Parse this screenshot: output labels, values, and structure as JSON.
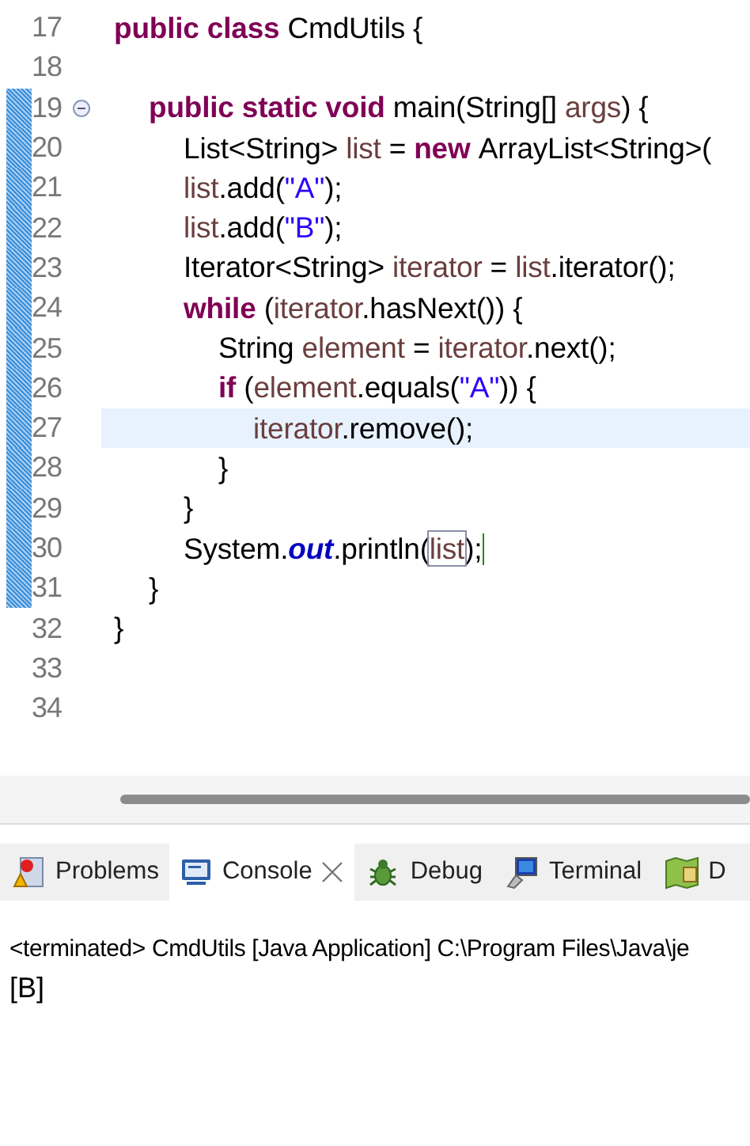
{
  "editor": {
    "lines": [
      {
        "number": "17",
        "changed": false,
        "current": false,
        "tokens": [
          {
            "text": "public class ",
            "kind": "keyword"
          },
          {
            "text": "CmdUtils {",
            "kind": "plain"
          }
        ],
        "children": [
          {
            "number": "18",
            "changed": false,
            "current": false
          },
          {
            "number": "19",
            "changed": true,
            "current": false,
            "folded": false,
            "tokens": [
              {
                "text": "public static void ",
                "kind": "keyword"
              },
              {
                "text": "main(String[] ",
                "kind": "plain"
              },
              {
                "text": "args",
                "kind": "local"
              },
              {
                "text": ") {",
                "kind": "plain"
              }
            ],
            "children": [
              {
                "number": "20",
                "changed": true,
                "current": false,
                "tokens": [
                  {
                    "text": "List<String> ",
                    "kind": "plain"
                  },
                  {
                    "text": "list",
                    "kind": "local"
                  },
                  {
                    "text": " = ",
                    "kind": "plain"
                  },
                  {
                    "text": "new ",
                    "kind": "keyword"
                  },
                  {
                    "text": "ArrayList<String>(",
                    "kind": "plain"
                  }
                ]
              },
              {
                "number": "21",
                "changed": true,
                "current": false,
                "tokens": [
                  {
                    "text": "list",
                    "kind": "local"
                  },
                  {
                    "text": ".add(",
                    "kind": "plain"
                  },
                  {
                    "text": "\"A\"",
                    "kind": "string"
                  },
                  {
                    "text": ");",
                    "kind": "plain"
                  }
                ]
              },
              {
                "number": "22",
                "changed": true,
                "current": false,
                "tokens": [
                  {
                    "text": "list",
                    "kind": "local"
                  },
                  {
                    "text": ".add(",
                    "kind": "plain"
                  },
                  {
                    "text": "\"B\"",
                    "kind": "string"
                  },
                  {
                    "text": ");",
                    "kind": "plain"
                  }
                ]
              },
              {
                "number": "23",
                "changed": true,
                "current": false,
                "tokens": [
                  {
                    "text": "Iterator<String> ",
                    "kind": "plain"
                  },
                  {
                    "text": "iterator",
                    "kind": "local"
                  },
                  {
                    "text": " = ",
                    "kind": "plain"
                  },
                  {
                    "text": "list",
                    "kind": "local"
                  },
                  {
                    "text": ".iterator();",
                    "kind": "plain"
                  }
                ]
              },
              {
                "number": "24",
                "changed": true,
                "current": false,
                "tokens": [
                  {
                    "text": "while ",
                    "kind": "keyword"
                  },
                  {
                    "text": "(",
                    "kind": "plain"
                  },
                  {
                    "text": "iterator",
                    "kind": "local"
                  },
                  {
                    "text": ".hasNext()) {",
                    "kind": "plain"
                  }
                ],
                "children": [
                  {
                    "number": "25",
                    "changed": true,
                    "current": false,
                    "tokens": [
                      {
                        "text": "String ",
                        "kind": "plain"
                      },
                      {
                        "text": "element",
                        "kind": "local"
                      },
                      {
                        "text": " = ",
                        "kind": "plain"
                      },
                      {
                        "text": "iterator",
                        "kind": "local"
                      },
                      {
                        "text": ".next();",
                        "kind": "plain"
                      }
                    ]
                  },
                  {
                    "number": "26",
                    "changed": true,
                    "current": false,
                    "tokens": [
                      {
                        "text": "if ",
                        "kind": "keyword"
                      },
                      {
                        "text": "(",
                        "kind": "plain"
                      },
                      {
                        "text": "element",
                        "kind": "local"
                      },
                      {
                        "text": ".equals(",
                        "kind": "plain"
                      },
                      {
                        "text": "\"A\"",
                        "kind": "string"
                      },
                      {
                        "text": ")) {",
                        "kind": "plain"
                      }
                    ],
                    "children": [
                      {
                        "number": "27",
                        "changed": true,
                        "current": true,
                        "tokens": [
                          {
                            "text": "iterator",
                            "kind": "local"
                          },
                          {
                            "text": ".remove();",
                            "kind": "plain"
                          }
                        ]
                      }
                    ]
                  },
                  {
                    "number": "28",
                    "changed": true,
                    "current": false,
                    "tokens": [
                      {
                        "text": "}",
                        "kind": "plain"
                      }
                    ]
                  }
                ]
              },
              {
                "number": "29",
                "changed": true,
                "current": false,
                "tokens": [
                  {
                    "text": "}",
                    "kind": "plain"
                  }
                ]
              },
              {
                "number": "30",
                "changed": true,
                "current": false,
                "caret": true,
                "tokens": [
                  {
                    "text": "System.",
                    "kind": "plain"
                  },
                  {
                    "text": "out",
                    "kind": "field"
                  },
                  {
                    "text": ".println(",
                    "kind": "plain"
                  },
                  {
                    "text": "list",
                    "kind": "occurrence"
                  },
                  {
                    "text": ");",
                    "kind": "plain"
                  }
                ]
              }
            ]
          },
          {
            "number": "31",
            "changed": true,
            "current": false,
            "tokens": [
              {
                "text": "}",
                "kind": "plain"
              }
            ]
          }
        ]
      },
      {
        "number": "32",
        "changed": false,
        "current": false,
        "tokens": [
          {
            "text": "}",
            "kind": "plain"
          }
        ]
      },
      {
        "number": "33",
        "changed": false,
        "current": false
      },
      {
        "number": "34",
        "changed": false,
        "current": false
      }
    ]
  },
  "panel": {
    "tabs": [
      {
        "label": "Problems",
        "kind": "problems",
        "selected": false,
        "closable": false
      },
      {
        "label": "Console",
        "kind": "console",
        "selected": true,
        "closable": true
      },
      {
        "label": "Debug",
        "kind": "debug",
        "selected": false,
        "closable": false
      },
      {
        "label": "Terminal",
        "kind": "terminal",
        "selected": false,
        "closable": false
      },
      {
        "label": "D",
        "kind": "map",
        "selected": false,
        "closable": false
      }
    ],
    "status": "<terminated> CmdUtils [Java Application] C:\\Program Files\\Java\\je",
    "output": [
      "[B]"
    ]
  }
}
